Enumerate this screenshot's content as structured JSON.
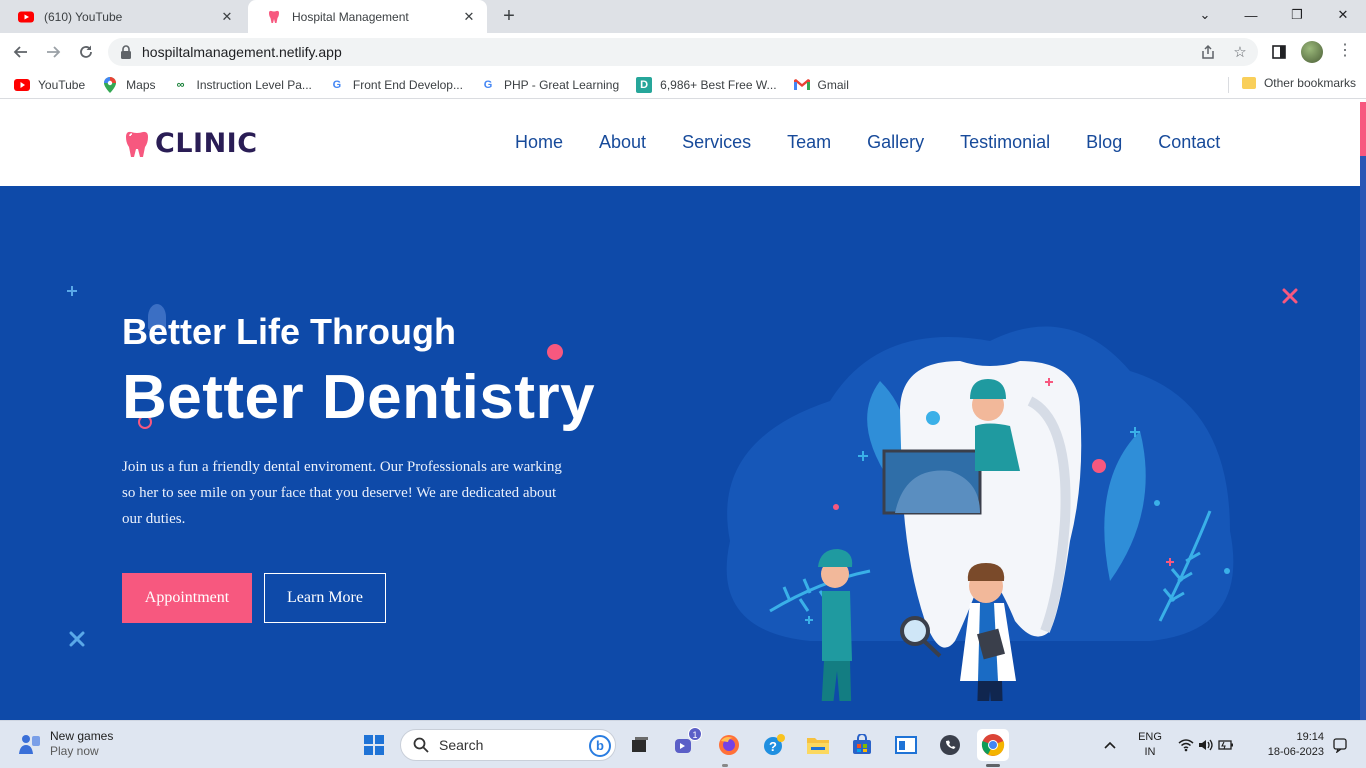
{
  "browser": {
    "tabs": [
      {
        "title": "(610) YouTube",
        "active": false
      },
      {
        "title": "Hospital Management",
        "active": true
      }
    ],
    "url": "hospiltalmanagement.netlify.app",
    "bookmarks": [
      {
        "label": "YouTube",
        "icon": "youtube-icon"
      },
      {
        "label": "Maps",
        "icon": "maps-icon"
      },
      {
        "label": "Instruction Level Pa...",
        "icon": "link-icon"
      },
      {
        "label": "Front End Develop...",
        "icon": "g-icon"
      },
      {
        "label": "PHP - Great Learning",
        "icon": "g-icon"
      },
      {
        "label": "6,986+ Best Free W...",
        "icon": "d-icon"
      },
      {
        "label": "Gmail",
        "icon": "gmail-icon"
      }
    ],
    "other_bookmarks": "Other bookmarks"
  },
  "site": {
    "logo": "CLINIC",
    "nav": [
      "Home",
      "About",
      "Services",
      "Team",
      "Gallery",
      "Testimonial",
      "Blog",
      "Contact"
    ],
    "hero": {
      "subtitle": "Better Life Through",
      "title": "Better Dentistry",
      "description": "Join us a fun a friendly dental enviroment. Our Professionals are warking so her to see mile on your face that you deserve! We are dedicated about our duties.",
      "primary_button": "Appointment",
      "secondary_button": "Learn More"
    },
    "colors": {
      "primary": "#0e4aa9",
      "accent": "#f7587f",
      "nav_text": "#174a9a",
      "logo_text": "#2a1d55"
    }
  },
  "taskbar": {
    "widget_title": "New games",
    "widget_sub": "Play now",
    "search_placeholder": "Search",
    "teams_badge": "1",
    "lang_line1": "ENG",
    "lang_line2": "IN",
    "time": "19:14",
    "date": "18-06-2023"
  }
}
